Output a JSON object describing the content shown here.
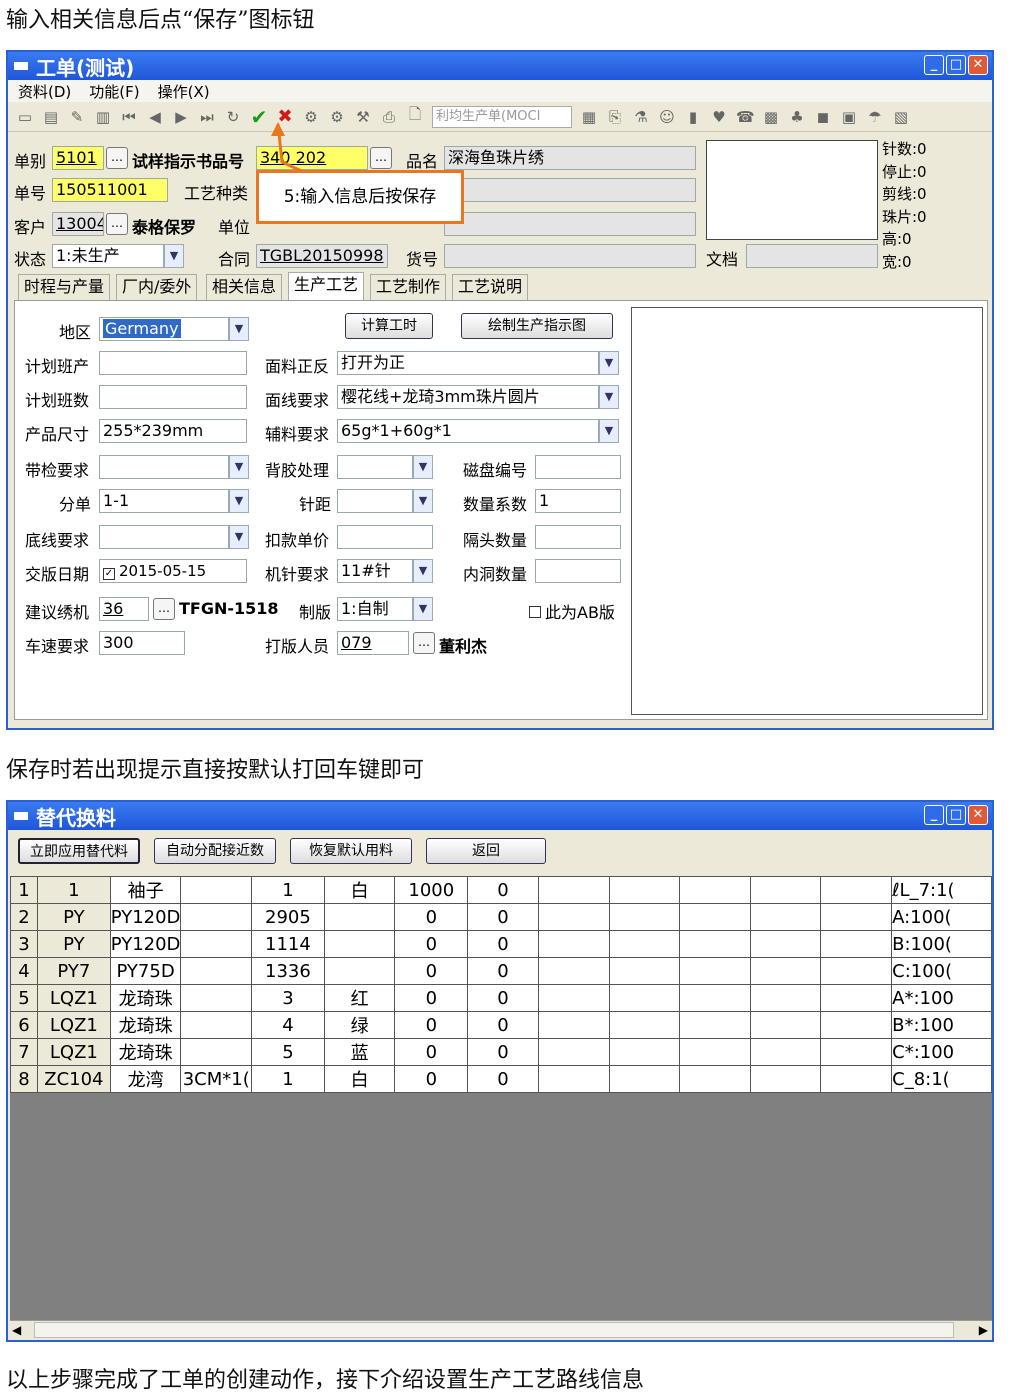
{
  "captions": {
    "top": "输入相关信息后点“保存”图标钮",
    "middle": "保存时若出现提示直接按默认打回车键即可",
    "bottom": "以上步骤完成了工单的创建动作，接下介绍设置生产工艺路线信息"
  },
  "work_order": {
    "title": "工单(测试)",
    "menu": [
      "资料(D)",
      "功能(F)",
      "操作(X)"
    ],
    "toolbar_combo": "利均生产单(MOCI",
    "callout": "5:输入信息后按保存",
    "fields": {
      "bill_type_label": "单别",
      "bill_type": "5101",
      "sample_book_label": "试样指示书品号",
      "sample_book": "340   202",
      "product_name_label": "品名",
      "product_name": "深海鱼珠片绣",
      "order_no_label": "单号",
      "order_no": "150511001",
      "process_type_label": "工艺种类",
      "customer_label": "客户",
      "customer_code": "13004",
      "customer_name": "泰格保罗",
      "unit_label": "单位",
      "status_label": "状态",
      "status": "1:未生产",
      "contract_label": "合同",
      "contract": "TGBL20150998",
      "goods_no_label": "货号",
      "document_label": "文档"
    },
    "stats": [
      "针数:0",
      "停止:0",
      "剪线:0",
      "珠片:0",
      "高:0",
      "宽:0"
    ],
    "tabs": [
      "时程与产量",
      "厂内/委外",
      "相关信息",
      "生产工艺",
      "工艺制作",
      "工艺说明"
    ],
    "process": {
      "region_label": "地区",
      "region": "Germany",
      "calc_button": "计算工时",
      "draw_button": "绘制生产指示图",
      "plan_shift_output_label": "计划班产",
      "plan_shift_output": "",
      "plan_shifts_label": "计划班数",
      "plan_shifts": "",
      "size_label": "产品尺寸",
      "size": "255*239mm",
      "fabric_side_label": "面料正反",
      "fabric_side": "打开为正",
      "face_thread_label": "面线要求",
      "face_thread": "樱花线+龙琦3mm珠片圆片",
      "aux_label": "辅料要求",
      "aux": "65g*1+60g*1",
      "inspect_label": "带检要求",
      "inspect": "",
      "backing_label": "背胶处理",
      "backing": "",
      "disk_label": "磁盘编号",
      "disk": "",
      "split_label": "分单",
      "split": "1-1",
      "stitch_label": "针距",
      "stitch": "",
      "qty_coef_label": "数量系数",
      "qty_coef": "1",
      "bottom_thread_label": "底线要求",
      "bottom_thread": "",
      "deduct_label": "扣款单价",
      "deduct": "",
      "spacer_label": "隔头数量",
      "spacer": "",
      "delivery_label": "交版日期",
      "delivery": "2015-05-15",
      "needle_label": "机针要求",
      "needle": "11#针",
      "inner_hole_label": "内洞数量",
      "inner_hole": "",
      "machine_label": "建议绣机",
      "machine_code": "36",
      "machine_name": "TFGN-1518",
      "plate_label": "制版",
      "plate": "1:自制",
      "ab_label": "此为AB版",
      "speed_label": "车速要求",
      "speed": "300",
      "maker_label": "打版人员",
      "maker_code": "079",
      "maker_name": "董利杰"
    }
  },
  "replace": {
    "title": "替代换料",
    "buttons": [
      "立即应用替代料",
      "自动分配接近数",
      "恢复默认用料",
      "返回"
    ],
    "rows": [
      [
        "1",
        "1",
        "袖子",
        "",
        "1",
        "白",
        "1000",
        "0",
        "ℓL_7:1("
      ],
      [
        "2",
        "PY",
        "PY120D",
        "",
        "2905",
        "",
        "0",
        "0",
        "A:100("
      ],
      [
        "3",
        "PY",
        "PY120D",
        "",
        "1114",
        "",
        "0",
        "0",
        "B:100("
      ],
      [
        "4",
        "PY7",
        "PY75D",
        "",
        "1336",
        "",
        "0",
        "0",
        "C:100("
      ],
      [
        "5",
        "LQZ1",
        "龙琦珠",
        "",
        "3",
        "红",
        "0",
        "0",
        "A*:100"
      ],
      [
        "6",
        "LQZ1",
        "龙琦珠",
        "",
        "4",
        "绿",
        "0",
        "0",
        "B*:100"
      ],
      [
        "7",
        "LQZ1",
        "龙琦珠",
        "",
        "5",
        "蓝",
        "0",
        "0",
        "C*:100"
      ],
      [
        "8",
        "ZC104",
        "龙湾",
        "3CM*1(",
        "1",
        "白",
        "0",
        "0",
        "C_8:1("
      ]
    ]
  }
}
